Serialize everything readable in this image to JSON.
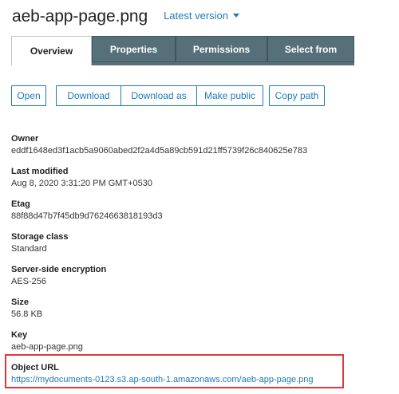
{
  "header": {
    "file_title": "aeb-app-page.png",
    "version_label": "Latest version"
  },
  "tabs": [
    {
      "label": "Overview",
      "active": true
    },
    {
      "label": "Properties",
      "active": false
    },
    {
      "label": "Permissions",
      "active": false
    },
    {
      "label": "Select from",
      "active": false
    }
  ],
  "actions": {
    "open": "Open",
    "download": "Download",
    "download_as": "Download as",
    "make_public": "Make public",
    "copy_path": "Copy path"
  },
  "properties": {
    "owner": {
      "label": "Owner",
      "value": "eddf1648ed3f1acb5a9060abed2f2a4d5a89cb591d21ff5739f26c840625e783"
    },
    "last_modified": {
      "label": "Last modified",
      "value": "Aug 8, 2020 3:31:20 PM GMT+0530"
    },
    "etag": {
      "label": "Etag",
      "value": "88f88d47b7f45db9d7624663818193d3"
    },
    "storage_class": {
      "label": "Storage class",
      "value": "Standard"
    },
    "encryption": {
      "label": "Server-side encryption",
      "value": "AES-256"
    },
    "size": {
      "label": "Size",
      "value": "56.8 KB"
    },
    "key": {
      "label": "Key",
      "value": "aeb-app-page.png"
    },
    "object_url": {
      "label": "Object URL",
      "value": "https://mydocuments-0123.s3.ap-south-1.amazonaws.com/aeb-app-page.png"
    }
  },
  "colors": {
    "link": "#1f7ab8",
    "tab_inactive": "#56707a",
    "highlight": "#e0373d"
  }
}
